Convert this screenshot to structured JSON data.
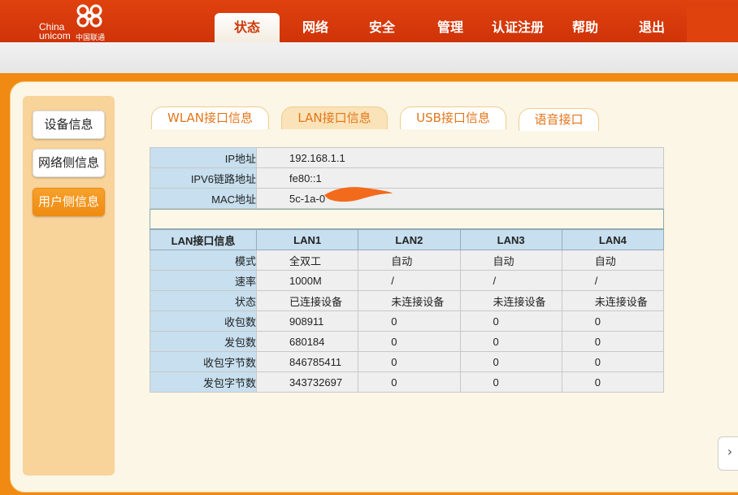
{
  "logo": {
    "en_line1": "China",
    "en_line2": "unicom",
    "cn": "中国联通"
  },
  "topnav": [
    {
      "label": "状态"
    },
    {
      "label": "网络"
    },
    {
      "label": "安全"
    },
    {
      "label": "管理"
    },
    {
      "label": "认证注册"
    },
    {
      "label": "帮助"
    },
    {
      "label": "退出"
    }
  ],
  "active_topnav": "状态",
  "sidebar": [
    {
      "label": "设备信息"
    },
    {
      "label": "网络侧信息"
    },
    {
      "label": "用户侧信息"
    }
  ],
  "active_sidebar": "用户侧信息",
  "tabs": [
    {
      "label": "WLAN接口信息"
    },
    {
      "label": "LAN接口信息"
    },
    {
      "label": "USB接口信息"
    },
    {
      "label": "语音接口"
    }
  ],
  "active_tab": "LAN接口信息",
  "info": [
    {
      "label": "IP地址",
      "value": "192.168.1.1"
    },
    {
      "label": "IPV6链路地址",
      "value": "fe80::1"
    },
    {
      "label": "MAC地址",
      "value": "5c-1a-0"
    }
  ],
  "lan": {
    "headers": [
      "LAN接口信息",
      "LAN1",
      "LAN2",
      "LAN3",
      "LAN4"
    ],
    "rows": [
      {
        "label": "模式",
        "values": [
          "全双工",
          "自动",
          "自动",
          "自动"
        ]
      },
      {
        "label": "速率",
        "values": [
          "1000M",
          "/",
          "/",
          "/"
        ]
      },
      {
        "label": "状态",
        "values": [
          "已连接设备",
          "未连接设备",
          "未连接设备",
          "未连接设备"
        ]
      },
      {
        "label": "收包数",
        "values": [
          "908911",
          "0",
          "0",
          "0"
        ]
      },
      {
        "label": "发包数",
        "values": [
          "680184",
          "0",
          "0",
          "0"
        ]
      },
      {
        "label": "收包字节数",
        "values": [
          "846785411",
          "0",
          "0",
          "0"
        ]
      },
      {
        "label": "发包字节数",
        "values": [
          "343732697",
          "0",
          "0",
          "0"
        ]
      }
    ]
  },
  "colors": {
    "header_red": "#cf3308",
    "page_orange": "#f08a12",
    "tab_text": "#e2761a",
    "label_blue": "#c7dfee",
    "redaction": "#f26a1b"
  },
  "side_arrow": "›"
}
